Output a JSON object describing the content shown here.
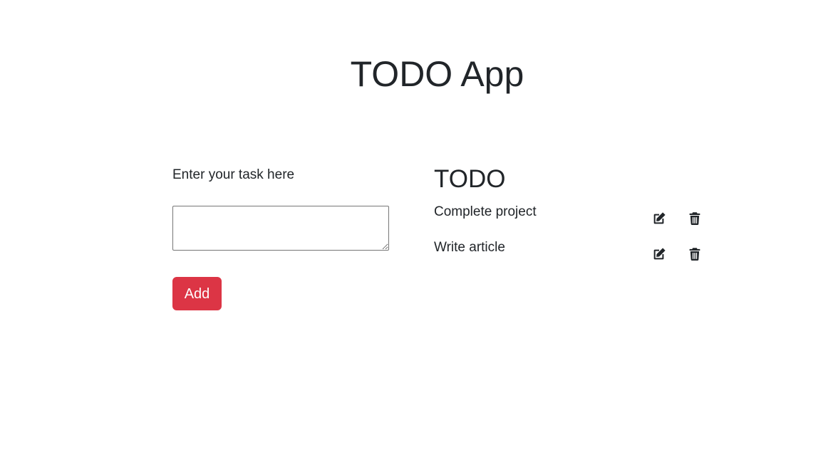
{
  "header": {
    "title": "TODO App"
  },
  "form": {
    "label": "Enter your task here",
    "input_value": "",
    "input_placeholder": "",
    "add_label": "Add",
    "add_button_color": "#dc3545"
  },
  "list": {
    "title": "TODO",
    "items": [
      {
        "text": "Complete project",
        "edit_icon": "edit-icon",
        "delete_icon": "trash-icon"
      },
      {
        "text": "Write article",
        "edit_icon": "edit-icon",
        "delete_icon": "trash-icon"
      }
    ]
  }
}
